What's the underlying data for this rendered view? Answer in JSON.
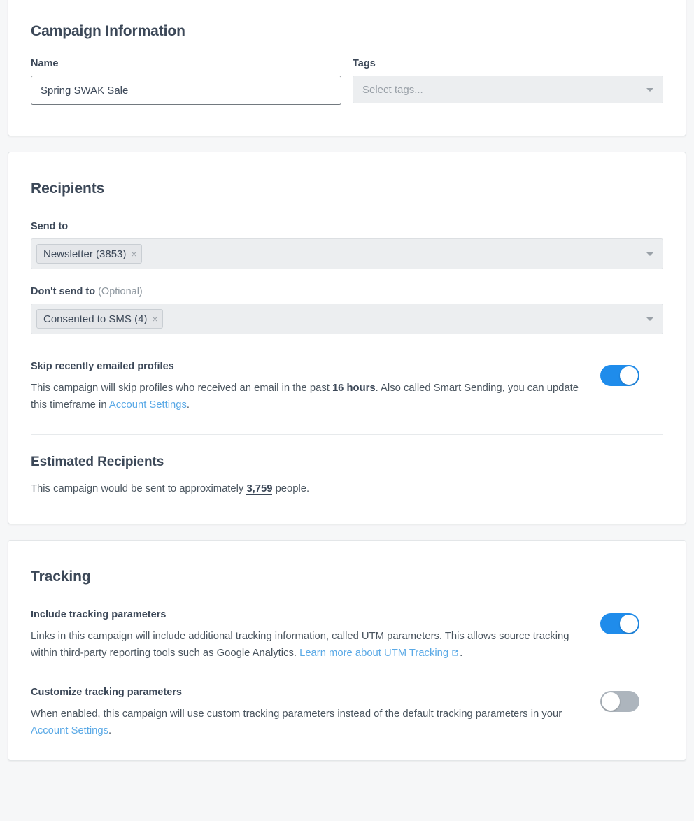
{
  "campaign_information": {
    "title": "Campaign Information",
    "name_label": "Name",
    "name_value": "Spring SWAK Sale",
    "tags_label": "Tags",
    "tags_placeholder": "Select tags...",
    "tags_selected": ""
  },
  "recipients": {
    "title": "Recipients",
    "send_to_label": "Send to",
    "send_to_chips": [
      {
        "label": "Newsletter (3853)",
        "remove": "×"
      }
    ],
    "dont_send_to_label": "Don't send to",
    "dont_send_to_optional": "(Optional)",
    "dont_send_to_chips": [
      {
        "label": "Consented to SMS (4)",
        "remove": "×"
      }
    ],
    "skip_recent": {
      "label": "Skip recently emailed profiles",
      "text_part1": "This campaign will skip profiles who received an email in the past ",
      "bold_value": "16 hours",
      "text_part2": ". Also called Smart Sending, you can update this timeframe in ",
      "link_text": "Account Settings",
      "text_part3": ".",
      "toggle_state": "on"
    },
    "estimated": {
      "title": "Estimated Recipients",
      "text_part1": "This campaign would be sent to approximately ",
      "count": "3,759",
      "text_part2": " people."
    }
  },
  "tracking": {
    "title": "Tracking",
    "include_params": {
      "label": "Include tracking parameters",
      "text_part1": "Links in this campaign will include additional tracking information, called UTM parameters. This allows source tracking within third-party reporting tools such as Google Analytics. ",
      "link_text": "Learn more about UTM Tracking",
      "text_part2": ".",
      "toggle_state": "on"
    },
    "customize_params": {
      "label": "Customize tracking parameters",
      "text_part1": "When enabled, this campaign will use custom tracking parameters instead of the default tracking parameters in your ",
      "link_text": "Account Settings",
      "text_part2": ".",
      "toggle_state": "off"
    }
  },
  "colors": {
    "toggle_on": "#1f8ceb",
    "toggle_off": "#adb5bd",
    "link": "#5aa9e6",
    "heading": "#3c4858",
    "page_bg": "#f6f7f8"
  }
}
